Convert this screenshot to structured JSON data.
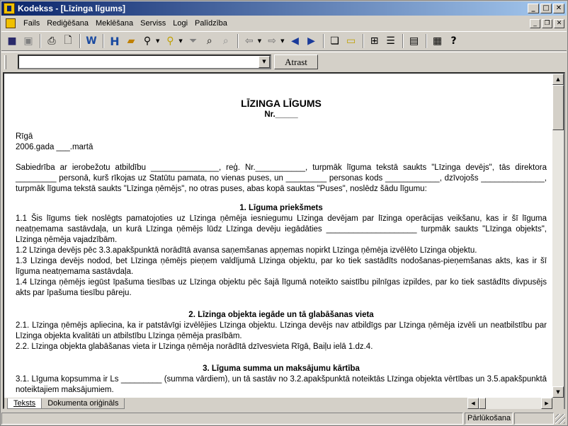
{
  "window": {
    "title": "Kodekss - [Līzinga līgums]"
  },
  "menu": [
    "Fails",
    "Rediģēšana",
    "Meklēšana",
    "Serviss",
    "Logi",
    "Palīdzība"
  ],
  "search": {
    "value": "",
    "button": "Atrast"
  },
  "document": {
    "title": "LĪZINGA LĪGUMS",
    "number": "Nr._____",
    "place": "Rīgā",
    "date": "2006.gada ___.martā",
    "intro": "Sabiedrība ar ierobežotu atbildību _______________, reģ. Nr.___________, turpmāk līguma tekstā saukts \"Līzinga devējs\", tās direktora _________ personā, kurš rīkojas uz Statūtu pamata, no vienas puses, un _________ personas kods ____________, dzīvojošs ______________, turpmāk līguma tekstā saukts \"Līzinga ņēmējs\", no otras puses, abas kopā sauktas \"Puses\", noslēdz šādu līgumu:",
    "s1_title": "1. Līguma priekšmets",
    "s1_1": "1.1 Šis līgums tiek noslēgts pamatojoties uz Līzinga ņēmēja iesniegumu Līzinga devējam par līzinga operācijas veikšanu, kas ir šī līguma neatņemama sastāvdaļa, un kurā Līzinga ņēmējs lūdz Līzinga devēju iegādāties ____________________ turpmāk saukts \"Līzinga objekts\", Līzinga ņēmēja vajadzībām.",
    "s1_2": "1.2 Līzinga devējs pēc 3.3.apakšpunktā norādītā avansa saņemšanas apņemas nopirkt Līzinga ņēmēja izvēlēto Līzinga objektu.",
    "s1_3": "1.3 Līzinga devējs nodod, bet Līzinga ņēmējs pieņem valdījumā Līzinga objektu, par ko tiek sastādīts nodošanas-pieņemšanas akts, kas ir šī līguma neatņemama sastāvdaļa.",
    "s1_4": "1.4 Līzinga ņēmējs iegūst īpašuma tiesības uz Līzinga objektu pēc šajā līgumā noteikto saistību pilnīgas izpildes, par ko tiek sastādīts divpusējs akts par īpašuma tiesību pāreju.",
    "s2_title": "2. Līzinga objekta iegāde un tā glabāšanas vieta",
    "s2_1": "2.1.  Līzinga ņēmējs apliecina, ka ir patstāvīgi izvēlējies Līzinga objektu. Līzinga devējs nav atbildīgs par Līzinga ņēmēja izvēli un neatbilstību par Līzinga objekta kvalitāti un atbilstību Līzinga ņēmēja prasībām.",
    "s2_2": "2.2.  Līzinga objekta glabāšanas vieta ir Līzinga ņēmēja norādītā dzīvesvieta Rīgā, Baiļu ielā 1.dz.4.",
    "s3_title": "3. Līguma summa un maksājumu kārtība",
    "s3_1": "3.1.  Līguma kopsumma ir Ls _________ (summa vārdiem), un tā sastāv no 3.2.apakšpunktā noteiktās Līzinga objekta vērtības un 3.5.apakšpunktā noteiktajiem maksājumiem."
  },
  "tabs": [
    "Teksts",
    "Dokumenta oriģināls"
  ],
  "status": {
    "mode": "Pārlūkošana"
  }
}
